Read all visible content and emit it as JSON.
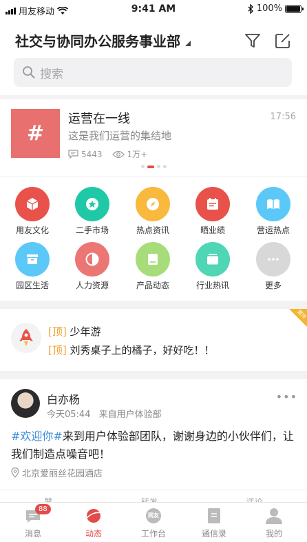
{
  "status_bar": {
    "carrier": "用友移动",
    "time": "9:41 AM",
    "battery": "100%"
  },
  "header": {
    "title": "社交与协同办公服务事业部",
    "search_placeholder": "搜索"
  },
  "banner": {
    "icon_glyph": "#",
    "title": "运营在一线",
    "subtitle": "这是我们运营的集结地",
    "time": "17:56",
    "comments": "5443",
    "views": "1万+",
    "page_indicator": {
      "pages": 4,
      "active": 1
    }
  },
  "grid": {
    "items": [
      {
        "label": "用友文化",
        "color": "#e8524a",
        "icon": "cube-icon"
      },
      {
        "label": "二手市场",
        "color": "#1fc9a7",
        "icon": "star-icon"
      },
      {
        "label": "热点资讯",
        "color": "#f8b93d",
        "icon": "compass-icon"
      },
      {
        "label": "晒业绩",
        "color": "#e8524a",
        "icon": "calendar-icon"
      },
      {
        "label": "营运热点",
        "color": "#5bc8f7",
        "icon": "book-icon"
      },
      {
        "label": "园区生活",
        "color": "#5bc8f7",
        "icon": "box-icon"
      },
      {
        "label": "人力资源",
        "color": "#ec7674",
        "icon": "half-circle-icon"
      },
      {
        "label": "产品动态",
        "color": "#a6dd7a",
        "icon": "tablet-icon"
      },
      {
        "label": "行业热讯",
        "color": "#4fd6b4",
        "icon": "layers-icon"
      },
      {
        "label": "更多",
        "color": "#d8d8d8",
        "icon": "more-icon"
      }
    ]
  },
  "pinned": {
    "tag": "[顶]",
    "ribbon": "置顶",
    "items": [
      {
        "text": "少年游"
      },
      {
        "text": "刘秀桌子上的橘子，好好吃！！"
      }
    ]
  },
  "post": {
    "author": "白亦杨",
    "time": "今天05:44",
    "source": "来自用户体验部",
    "hashtag": "#欢迎你#",
    "body": "来到用户体验部团队，谢谢身边的小伙伴们，让我们制造点噪音吧！",
    "location": "北京爱丽丝花园酒店",
    "actions": {
      "like": "赞",
      "forward": "转发",
      "comment": "评论"
    }
  },
  "tabbar": {
    "items": [
      {
        "label": "消息",
        "badge": "88"
      },
      {
        "label": "动态"
      },
      {
        "label": "工作台",
        "icon_text": "网友"
      },
      {
        "label": "通信录"
      },
      {
        "label": "我的"
      }
    ]
  },
  "colors": {
    "accent": "#e34b4b",
    "pin_tag": "#f0a12c",
    "hashtag": "#3a8ed8"
  }
}
